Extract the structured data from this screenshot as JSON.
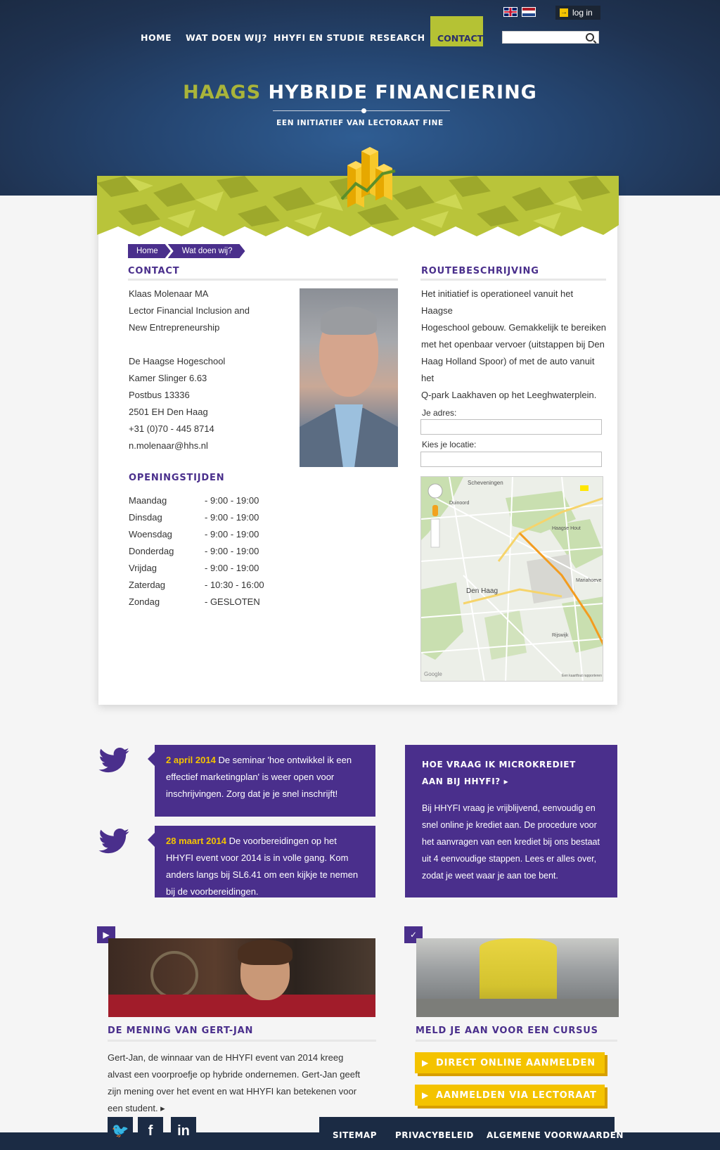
{
  "header": {
    "login_label": "log in",
    "title_accent": "HAAGS",
    "title_main": "HYBRIDE FINANCIERING",
    "subtitle": "EEN INITIATIEF VAN LECTORAAT FINE",
    "search_placeholder": ""
  },
  "nav": {
    "items": [
      "HOME",
      "WAT DOEN WIJ?",
      "HHYFI EN STUDIE",
      "RESEARCH",
      "CONTACT"
    ]
  },
  "breadcrumb": [
    "Home",
    "Wat doen wij?"
  ],
  "contact": {
    "heading": "CONTACT",
    "lines": [
      "Klaas Molenaar MA",
      "Lector Financial Inclusion and",
      "New Entrepreneurship",
      "",
      "De Haagse Hogeschool",
      "Kamer Slinger 6.63",
      "Postbus 13336",
      "2501 EH Den Haag",
      "+31 (0)70 - 445 8714",
      "n.molenaar@hhs.nl"
    ]
  },
  "hours": {
    "heading": "OPENINGSTIJDEN",
    "rows": [
      {
        "day": "Maandag",
        "time": "- 9:00 - 19:00"
      },
      {
        "day": "Dinsdag",
        "time": "- 9:00 - 19:00"
      },
      {
        "day": "Woensdag",
        "time": "- 9:00 - 19:00"
      },
      {
        "day": "Donderdag",
        "time": "- 9:00 - 19:00"
      },
      {
        "day": "Vrijdag",
        "time": "- 9:00 - 19:00"
      },
      {
        "day": "Zaterdag",
        "time": "- 10:30 - 16:00"
      },
      {
        "day": "Zondag",
        "time": "- GESLOTEN"
      }
    ]
  },
  "route": {
    "heading": "ROUTEBESCHRIJVING",
    "lines": [
      "Het initiatief is operationeel vanuit het Haagse",
      "Hogeschool gebouw. Gemakkelijk te bereiken",
      "met het openbaar vervoer (uitstappen bij Den",
      "Haag Holland Spoor) of met de auto vanuit het",
      "Q-park Laakhaven op het Leeghwaterplein."
    ],
    "address_label": "Je adres:",
    "location_label": "Kies je locatie:"
  },
  "map": {
    "labels": [
      "Scheveningen",
      "Duinoord",
      "Den Haag",
      "Haagse Hout",
      "Rijswijk",
      "Mariahoeve",
      "Google",
      "Een kaartfout rapporteren"
    ]
  },
  "tweets": [
    {
      "date": "2 april 2014",
      "text": " De seminar 'hoe ontwikkel ik een effectief marketingplan' is weer open voor inschrijvingen. Zorg dat je je snel inschrijft!"
    },
    {
      "date": "28 maart 2014",
      "text": " De voorbereidingen op het HHYFI event voor 2014 is in volle gang. Kom anders langs bij SL6.41 om een kijkje te nemen bij de voorbereidingen."
    }
  ],
  "promo": {
    "heading": "HOE VRAAG IK MICROKREDIET AAN BIJ HHYFI? ▸",
    "text": "Bij HHYFI vraag je vrijblijvend, eenvoudig en snel online je krediet aan. De procedure voor het aanvragen van een krediet bij ons bestaat uit 4 eenvoudige stappen. Lees er alles over, zodat je weet waar je aan toe bent."
  },
  "opinion": {
    "heading": "DE MENING VAN GERT-JAN",
    "text": "Gert-Jan, de winnaar van de HHYFI  event van 2014 kreeg alvast een voorproefje op hybride ondernemen. Gert-Jan geeft zijn mening over het event en wat HHYFI kan betekenen voor een student. ▸"
  },
  "course": {
    "heading": "MELD JE AAN VOOR EEN CURSUS",
    "btn_online": "DIRECT ONLINE AANMELDEN",
    "btn_lectoraat": "AANMELDEN VIA LECTORAAT"
  },
  "footer": {
    "links": [
      "SITEMAP",
      "PRIVACYBELEID",
      "ALGEMENE VOORWAARDEN"
    ],
    "social": [
      "twitter",
      "f",
      "in"
    ]
  },
  "colors": {
    "purple": "#4a2f8c",
    "lime": "#b5c234",
    "yellow": "#f4c300",
    "navy": "#1b2b44"
  }
}
